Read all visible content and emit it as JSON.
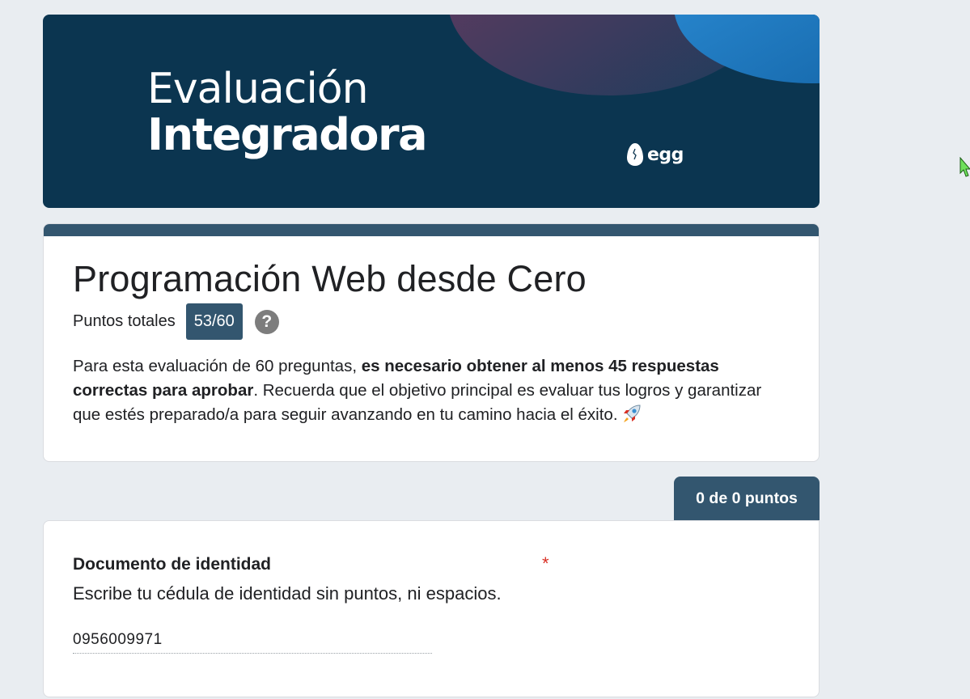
{
  "banner": {
    "title_line1": "Evaluación",
    "title_line2": "Integradora",
    "logo_text": "egg",
    "background_color": "#0b3550"
  },
  "form": {
    "title": "Programación Web desde Cero",
    "points_label": "Puntos totales",
    "points_value": "53/60",
    "help_icon": "question-circle-icon",
    "description": {
      "part1": "Para esta evaluación de 60 preguntas, ",
      "bold": "es necesario obtener al menos 45 respuestas correctas para aprobar",
      "part2": ". Recuerda que el objetivo principal es evaluar tus logros y garantizar que estés preparado/a para seguir avanzando en tu camino hacia el éxito.",
      "emoji_icon": "rocket-icon"
    },
    "accent_color": "#33566f"
  },
  "section": {
    "score": "0 de 0 puntos"
  },
  "question": {
    "title": "Documento de identidad",
    "required_mark": "*",
    "help_text": "Escribe tu cédula de identidad sin puntos, ni espacios.",
    "answer": "0956009971"
  }
}
